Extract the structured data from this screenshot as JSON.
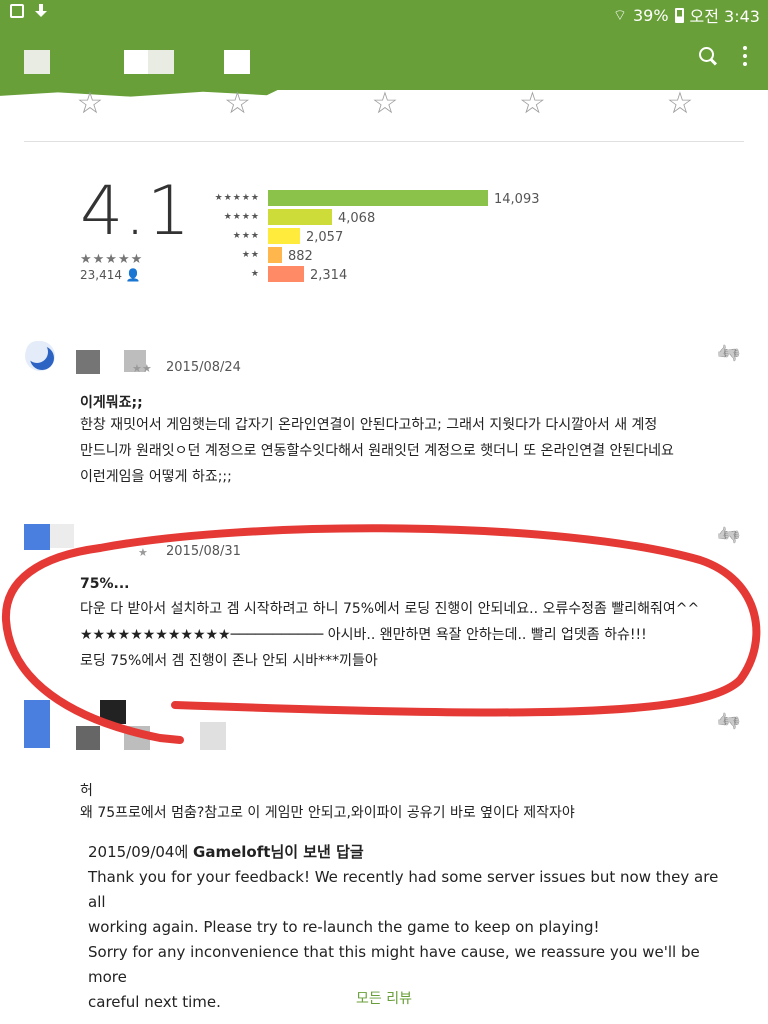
{
  "status_bar": {
    "battery": "39%",
    "time": "오전 3:43"
  },
  "colors": {
    "primary": "#689f38",
    "annotation_red": "#e53935",
    "bar_5": "#8bc34a",
    "bar_4": "#cddc39",
    "bar_3": "#ffeb3b",
    "bar_2": "#ffb74d",
    "bar_1": "#ff8a65"
  },
  "rating": {
    "average": "4.1",
    "total_reviews": "23,414",
    "summary_stars": "★★★★★",
    "histogram": [
      {
        "label": "★★★★★",
        "count_label": "14,093",
        "count": 14093,
        "color": "#8bc34a"
      },
      {
        "label": "★★★★",
        "count_label": "4,068",
        "count": 4068,
        "color": "#cddc39"
      },
      {
        "label": "★★★",
        "count_label": "2,057",
        "count": 2057,
        "color": "#ffeb3b"
      },
      {
        "label": "★★",
        "count_label": "882",
        "count": 882,
        "color": "#ffb74d"
      },
      {
        "label": "★",
        "count_label": "2,314",
        "count": 2314,
        "color": "#ff8a65"
      }
    ]
  },
  "rate_stars": [
    "☆",
    "☆",
    "☆",
    "☆",
    "☆"
  ],
  "reviews": [
    {
      "date": "2015/08/24",
      "stars": "★★",
      "title": "이게뭐죠;;",
      "body": [
        "한창 재밋어서 게임햇는데 갑자기 온라인연결이 안된다고하고; 그래서 지웟다가 다시깔아서 새 계정",
        "만드니까 원래잇ㅇ던 계정으로 연동할수잇다해서 원래잇던 계정으로 햇더니 또 온라인연결 안된다네요",
        "이런게임을 어떻게 하죠;;;"
      ]
    },
    {
      "date": "2015/08/31",
      "stars": "★",
      "title": "75%...",
      "body": [
        "다운 다 받아서 설치하고 겜 시작하려고 하니 75%에서 로딩 진행이 안되네요.. 오류수정좀 빨리해줘여^^",
        "★★★★★★★★★★★★─────────── 아시바.. 왠만하면 욕잘 안하는데.. 빨리 업뎃좀 하슈!!!",
        "로딩 75%에서 겜 진행이 존나 안되 시바***끼들아"
      ]
    },
    {
      "date": "",
      "stars": "",
      "title": "허",
      "body": [
        "왜 75프로에서 멈춤?참고로 이 게임만 안되고,와이파이 공유기 바로 옆이다 제작자야"
      ]
    }
  ],
  "developer_reply": {
    "date": "2015/09/04",
    "prefix": "에 ",
    "developer": "Gameloft",
    "suffix": "님이 보낸 답글",
    "lines": [
      "Thank you for your feedback! We recently had some server issues but now they are all",
      "working again. Please try to re-launch the game to keep on playing!",
      "Sorry for any inconvenience that this might have cause, we reassure you we'll be more",
      "careful next time."
    ]
  },
  "all_reviews_label": "모든 리뷰"
}
